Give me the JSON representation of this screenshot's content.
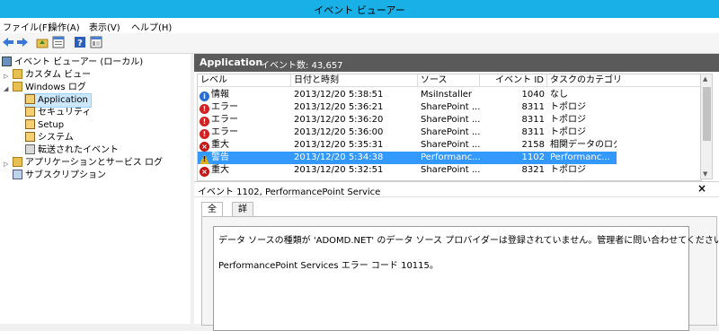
{
  "window": {
    "title": "イベント ビューアー"
  },
  "menu": [
    "ファイル(F)",
    "操作(A)",
    "表示(V)",
    "ヘルプ(H)"
  ],
  "toolbar": {
    "icons": [
      "back-icon",
      "forward-icon",
      "folder-up-icon",
      "properties-icon",
      "help-icon",
      "console-icon"
    ]
  },
  "tree": {
    "root": "イベント ビューアー (ローカル)",
    "items": [
      {
        "label": "カスタム ビュー",
        "level": 1
      },
      {
        "label": "Windows ログ",
        "level": 1
      },
      {
        "label": "Application",
        "level": 2,
        "selected": true
      },
      {
        "label": "セキュリティ",
        "level": 2
      },
      {
        "label": "Setup",
        "level": 2
      },
      {
        "label": "システム",
        "level": 2
      },
      {
        "label": "転送されたイベント",
        "level": 2
      },
      {
        "label": "アプリケーションとサービス ログ",
        "level": 1
      },
      {
        "label": "サブスクリプション",
        "level": 1
      }
    ]
  },
  "log": {
    "name": "Application",
    "count_label": "イベント数: 43,657"
  },
  "grid": {
    "columns": [
      "レベル",
      "日付と時刻",
      "ソース",
      "イベント ID",
      "タスクのカテゴリ"
    ],
    "rows": [
      {
        "level": "情報",
        "level_type": "info",
        "datetime": "2013/12/20 5:38:51",
        "source": "MsiInstaller",
        "id": "1040",
        "category": "なし"
      },
      {
        "level": "エラー",
        "level_type": "error",
        "datetime": "2013/12/20 5:36:21",
        "source": "SharePoint ...",
        "id": "8311",
        "category": "トポロジ"
      },
      {
        "level": "エラー",
        "level_type": "error",
        "datetime": "2013/12/20 5:36:20",
        "source": "SharePoint ...",
        "id": "8311",
        "category": "トポロジ"
      },
      {
        "level": "エラー",
        "level_type": "error",
        "datetime": "2013/12/20 5:36:00",
        "source": "SharePoint ...",
        "id": "8311",
        "category": "トポロジ"
      },
      {
        "level": "重大",
        "level_type": "critical",
        "datetime": "2013/12/20 5:35:31",
        "source": "SharePoint ...",
        "id": "2158",
        "category": "相関データのログ"
      },
      {
        "level": "警告",
        "level_type": "warning",
        "datetime": "2013/12/20 5:34:38",
        "source": "Performanc...",
        "id": "1102",
        "category": "Performanc...",
        "selected": true
      },
      {
        "level": "重大",
        "level_type": "critical",
        "datetime": "2013/12/20 5:32:51",
        "source": "SharePoint ...",
        "id": "8321",
        "category": "トポロジ"
      }
    ]
  },
  "detail": {
    "title": "イベント 1102, PerformancePoint Service",
    "close": "×",
    "tabs": [
      "全般",
      "詳細"
    ],
    "message_line1": "データ ソースの種類が 'ADOMD.NET' のデータ ソース プロバイダーは登録されていません。管理者に問い合わせてください。",
    "message_line2": "PerformancePoint Services エラー コード 10115。"
  },
  "colors": {
    "titlebar": "#19b0e8",
    "selection": "#3399ff",
    "header": "#5a5a5a"
  }
}
